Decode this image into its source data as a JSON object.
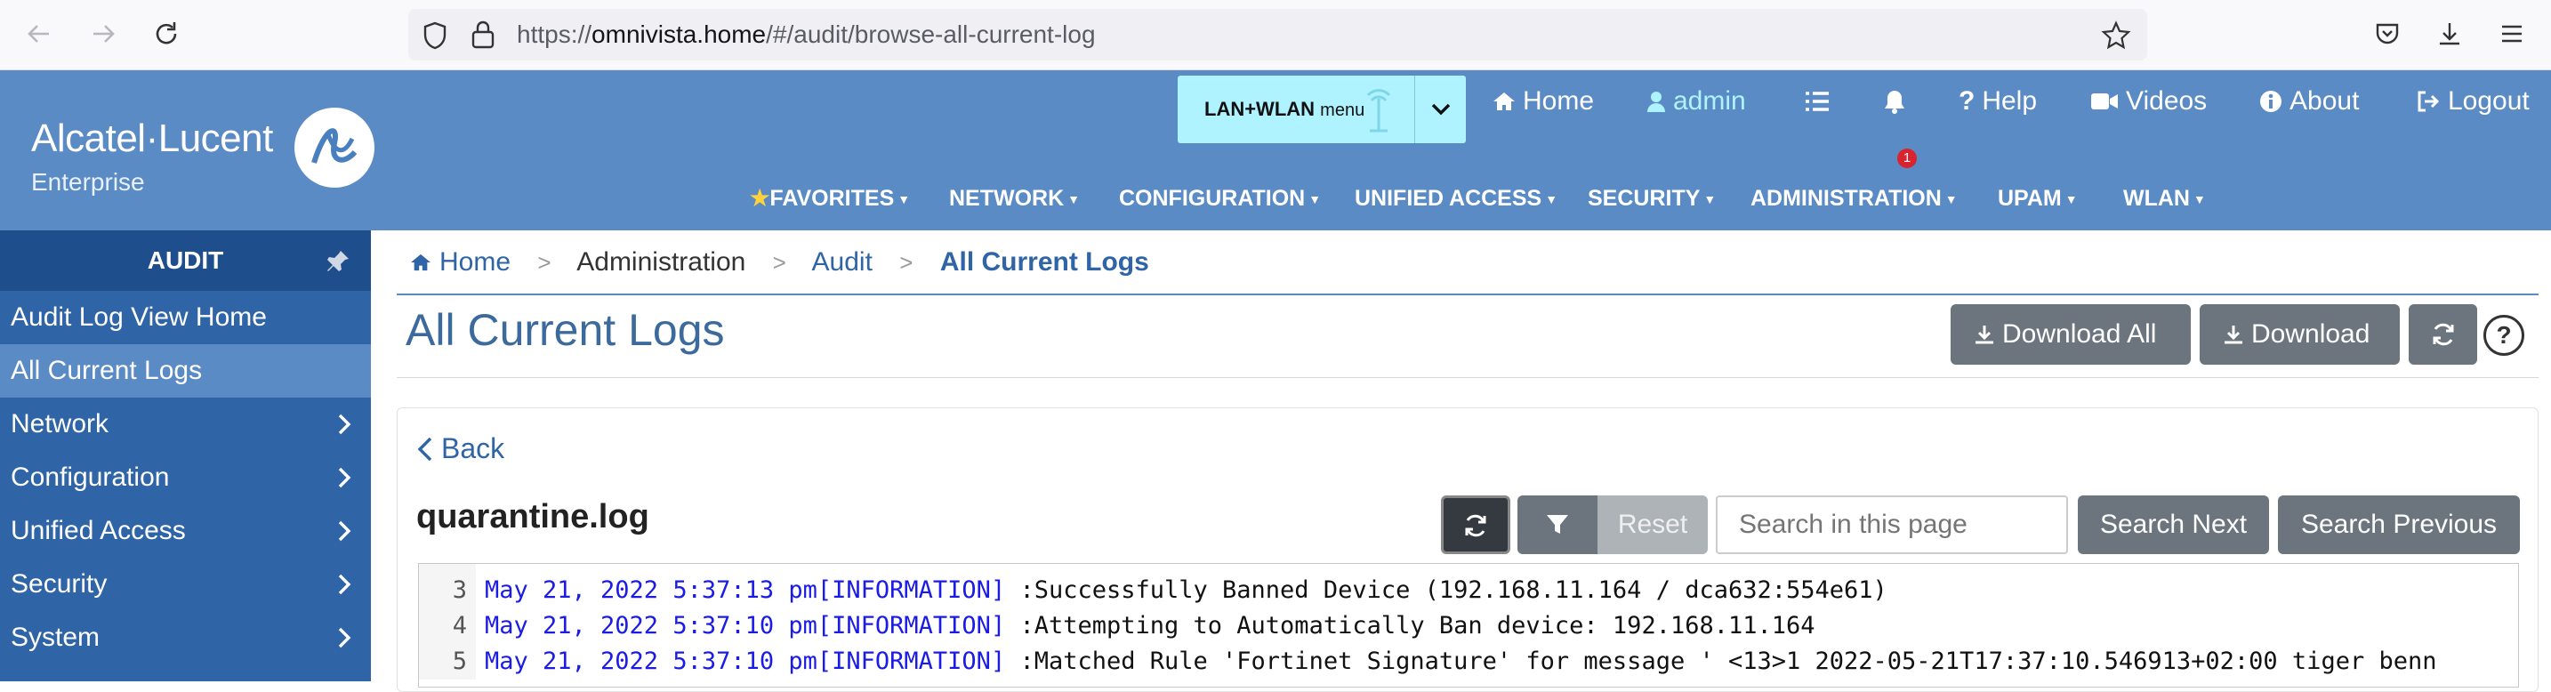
{
  "browser": {
    "url_prefix": "https://",
    "url_domain": "omnivista.home",
    "url_path": "/#/audit/browse-all-current-log"
  },
  "header": {
    "logo_text": "Alcatel·Lucent",
    "logo_sub": "Enterprise",
    "lan_menu_label": "LAN+WLAN",
    "lan_menu_small": "menu",
    "links": {
      "home": "Home",
      "admin": "admin",
      "notification_count": "1",
      "help": "Help",
      "videos": "Videos",
      "about": "About",
      "logout": "Logout"
    },
    "menus": [
      "FAVORITES",
      "NETWORK",
      "CONFIGURATION",
      "UNIFIED ACCESS",
      "SECURITY",
      "ADMINISTRATION",
      "UPAM",
      "WLAN"
    ]
  },
  "sidebar": {
    "title": "AUDIT",
    "items": [
      {
        "label": "Audit Log View Home"
      },
      {
        "label": "All Current Logs"
      },
      {
        "label": "Network"
      },
      {
        "label": "Configuration"
      },
      {
        "label": "Unified Access"
      },
      {
        "label": "Security"
      },
      {
        "label": "System"
      }
    ]
  },
  "breadcrumb": {
    "home": "Home",
    "sep": ">",
    "administration": "Administration",
    "audit": "Audit",
    "current": "All Current Logs"
  },
  "page": {
    "title": "All Current Logs",
    "download_all": "Download All",
    "download": "Download",
    "help": "?"
  },
  "log_view": {
    "back": "Back",
    "file_name": "quarantine.log",
    "reset": "Reset",
    "search_placeholder": "Search in this page",
    "search_next": "Search Next",
    "search_previous": "Search Previous",
    "lines": [
      {
        "num": "3",
        "date": "May 21, 2022 5:37:13 pm[INFORMATION]",
        "msg": " :Successfully Banned Device (192.168.11.164 / dca632:554e61)"
      },
      {
        "num": "4",
        "date": "May 21, 2022 5:37:10 pm[INFORMATION]",
        "msg": " :Attempting to Automatically Ban device: 192.168.11.164"
      },
      {
        "num": "5",
        "date": "May 21, 2022 5:37:10 pm[INFORMATION]",
        "msg": " :Matched Rule 'Fortinet Signature'  for message ' <13>1 2022-05-21T17:37:10.546913+02:00 tiger benn"
      }
    ]
  },
  "colors": {
    "header_bg": "#5a8bc4",
    "sidebar_bg": "#2f64a6",
    "sidebar_active": "#5a8bc4",
    "lan_menu_bg": "#aef3ff",
    "button_dark": "#6c757d",
    "log_date": "#1b1be6"
  }
}
